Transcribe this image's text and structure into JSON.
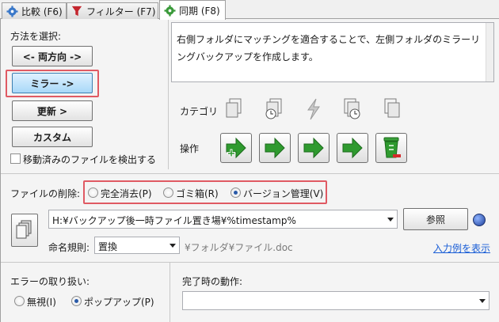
{
  "tabs": [
    {
      "label": "比較 (F6)",
      "icon": "gear-icon"
    },
    {
      "label": "フィルター (F7)",
      "icon": "funnel-icon"
    },
    {
      "label": "同期 (F8)",
      "icon": "gear-green-icon"
    }
  ],
  "method": {
    "heading": "方法を選択:",
    "two_way": "<- 両方向 ->",
    "mirror": "ミラー ->",
    "update": "更新 >",
    "custom": "カスタム",
    "detect_moved": "移動済みのファイルを検出する"
  },
  "description": "右側フォルダにマッチングを適合することで、左側フォルダのミラーリングバックアップを作成します。",
  "category_label": "カテゴリ",
  "operation_label": "操作",
  "deletion": {
    "label": "ファイルの削除:",
    "options": [
      "完全消去(P)",
      "ゴミ箱(R)",
      "バージョン管理(V)"
    ],
    "selected": 2
  },
  "version_path": "H:¥バックアップ後一時ファイル置き場¥%timestamp%",
  "browse_label": "参照",
  "naming": {
    "label": "命名規則:",
    "value": "置換",
    "example": "¥フォルダ¥ファイル.doc",
    "show_example": "入力例を表示"
  },
  "error": {
    "label": "エラーの取り扱い:",
    "options": [
      "無視(I)",
      "ポップアップ(P)"
    ],
    "selected": 1
  },
  "on_completion": {
    "label": "完了時の動作:",
    "value": ""
  }
}
